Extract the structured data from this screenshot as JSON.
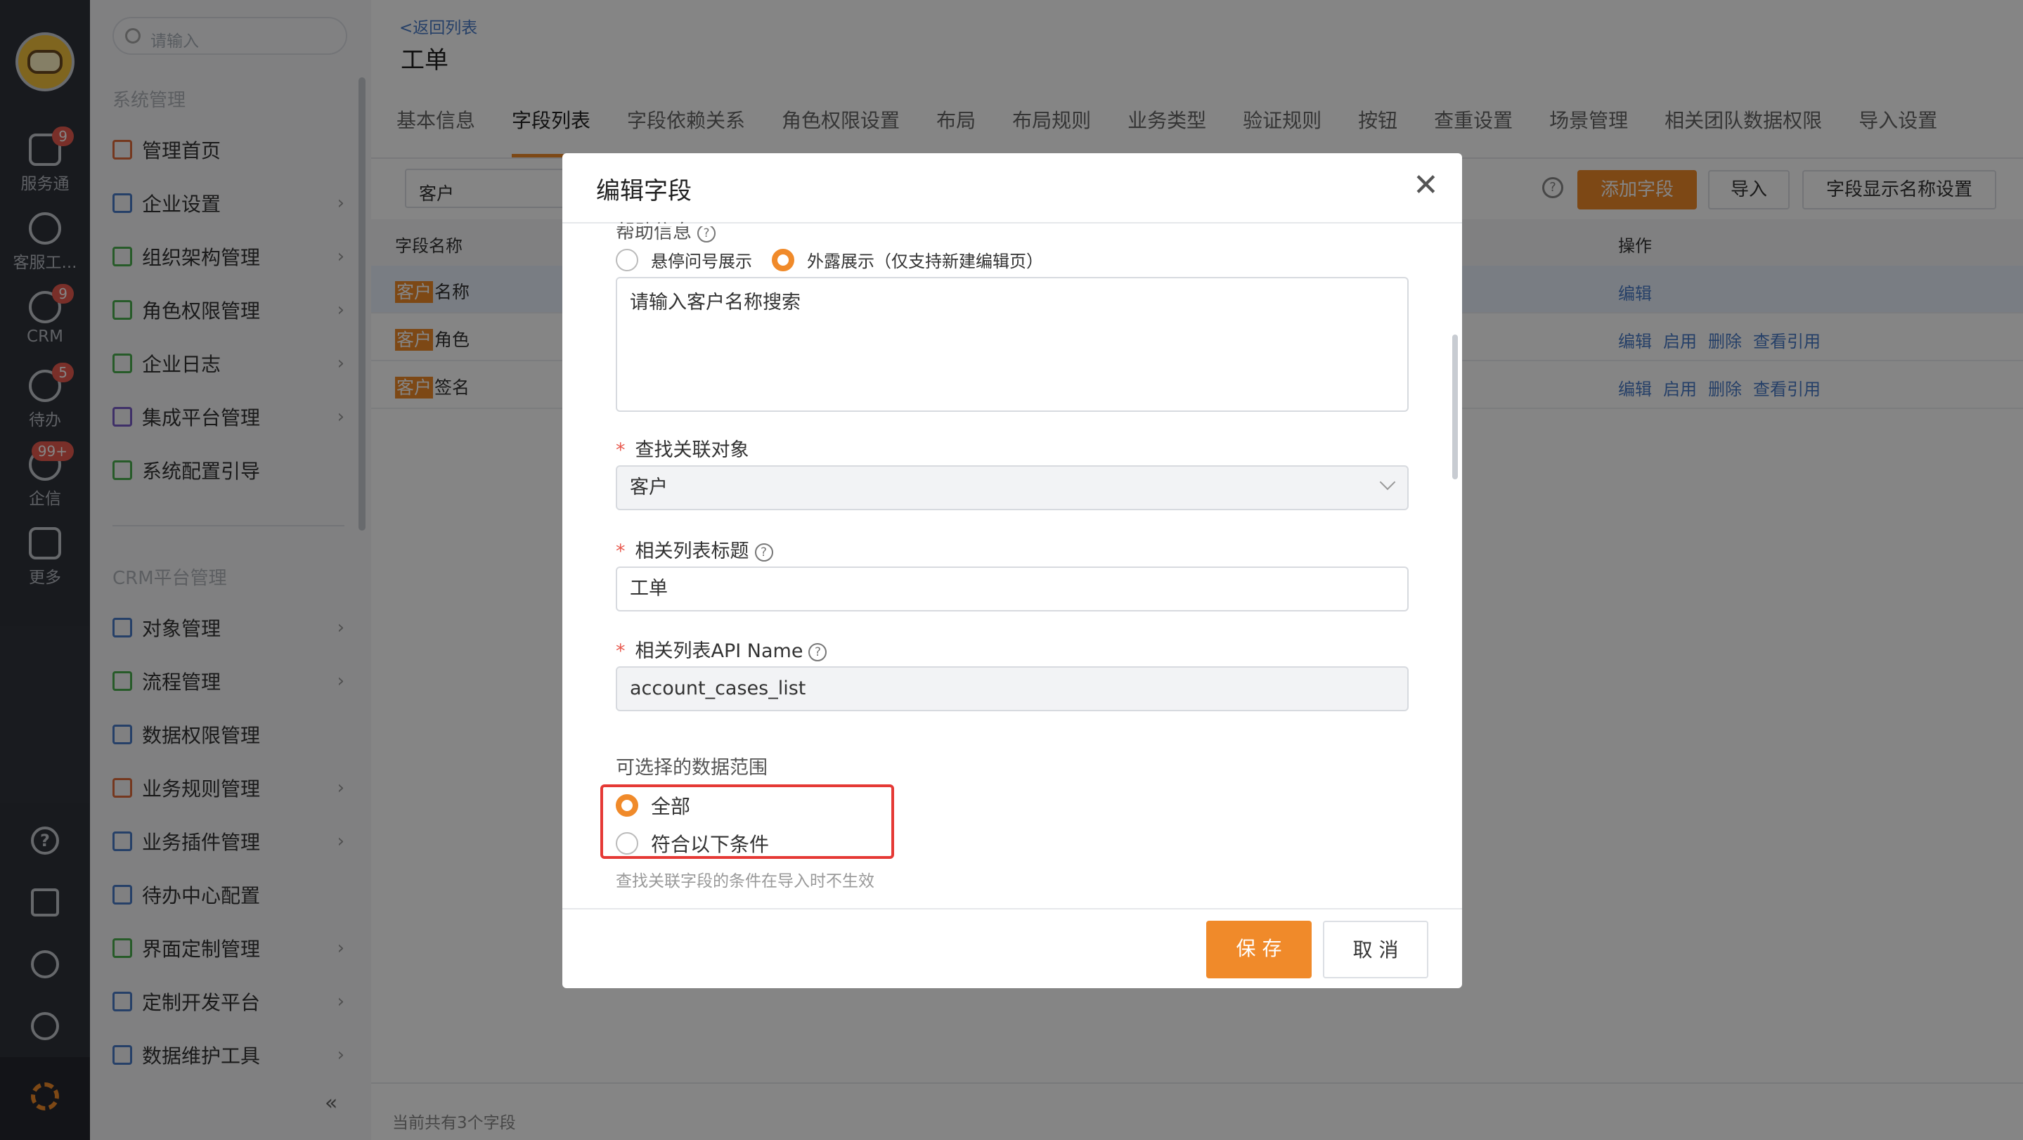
{
  "rail": {
    "items": [
      {
        "label": "服务通",
        "badge": "9"
      },
      {
        "label": "客服工...",
        "badge": ""
      },
      {
        "label": "CRM",
        "badge": "9"
      },
      {
        "label": "待办",
        "badge": "5"
      },
      {
        "label": "企信",
        "badge": "99+"
      },
      {
        "label": "更多",
        "badge": ""
      }
    ]
  },
  "nav": {
    "search_placeholder": "请输入",
    "section1": "系统管理",
    "section1_items": [
      "管理首页",
      "企业设置",
      "组织架构管理",
      "角色权限管理",
      "企业日志",
      "集成平台管理",
      "系统配置引导"
    ],
    "section2": "CRM平台管理",
    "section2_items": [
      "对象管理",
      "流程管理",
      "数据权限管理",
      "业务规则管理",
      "业务插件管理",
      "待办中心配置",
      "界面定制管理",
      "定制开发平台",
      "数据维护工具"
    ],
    "collapse": "«"
  },
  "header": {
    "back": "<返回列表",
    "title": "工单"
  },
  "tabs": [
    "基本信息",
    "字段列表",
    "字段依赖关系",
    "角色权限设置",
    "布局",
    "布局规则",
    "业务类型",
    "验证规则",
    "按钮",
    "查重设置",
    "场景管理",
    "相关团队数据权限",
    "导入设置"
  ],
  "toolbar": {
    "filter_value": "客户",
    "help": "?",
    "add_field": "添加字段",
    "import": "导入",
    "display_name_setting": "字段显示名称设置"
  },
  "table": {
    "col_name": "字段名称",
    "col_ops": "操作",
    "rows": [
      {
        "tag": "客户",
        "name": "名称",
        "ops": [
          "编辑"
        ]
      },
      {
        "tag": "客户",
        "name": "角色",
        "ops": [
          "编辑",
          "启用",
          "删除",
          "查看引用"
        ]
      },
      {
        "tag": "客户",
        "name": "签名",
        "ops": [
          "编辑",
          "启用",
          "删除",
          "查看引用"
        ]
      }
    ]
  },
  "footer": {
    "count_text": "当前共有3个字段"
  },
  "modal": {
    "title": "编辑字段",
    "close": "✕",
    "help_info_label": "帮助信息",
    "help_mode_hover": "悬停问号展示",
    "help_mode_expose": "外露展示（仅支持新建编辑页）",
    "help_text": "请输入客户名称搜索",
    "lookup_label": "查找关联对象",
    "lookup_value": "客户",
    "list_title_label": "相关列表标题",
    "list_title_value": "工单",
    "api_label": "相关列表API Name",
    "api_value": "account_cases_list",
    "range_label": "可选择的数据范围",
    "range_all": "全部",
    "range_condition": "符合以下条件",
    "hint": "查找关联字段的条件在导入时不生效",
    "save": "保 存",
    "cancel": "取 消"
  },
  "colors": {
    "accent": "#f08a2a",
    "link": "#4a7cc8",
    "highlight_box": "#e53935"
  }
}
